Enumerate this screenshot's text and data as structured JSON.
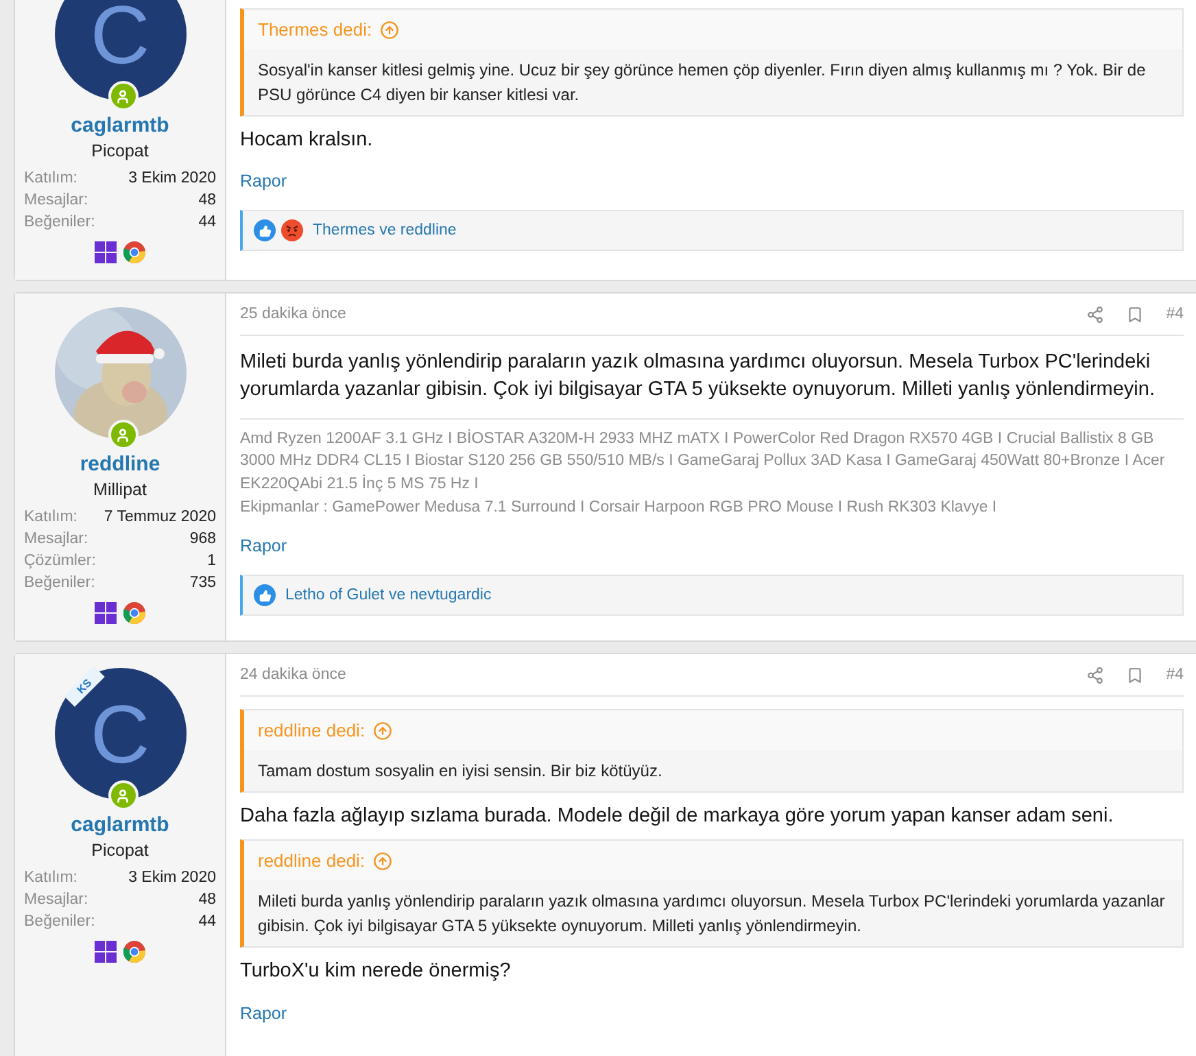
{
  "posts": [
    {
      "user": {
        "avatar": {
          "kind": "letter",
          "letter": "C"
        },
        "name": "caglarmtb",
        "role": "Picopat",
        "stats": [
          {
            "label": "Katılım:",
            "value": "3 Ekim 2020"
          },
          {
            "label": "Mesajlar:",
            "value": "48"
          },
          {
            "label": "Beğeniler:",
            "value": "44"
          }
        ]
      },
      "blocks": [
        {
          "kind": "quote",
          "author": "Thermes dedi:",
          "text": "Sosyal'in kanser kitlesi gelmiş yine. Ucuz bir şey görünce hemen çöp diyenler. Fırın diyen almış kullanmış mı ? Yok. Bir de PSU görünce C4 diyen bir kanser kitlesi var."
        },
        {
          "kind": "text",
          "text": "Hocam kralsın."
        }
      ],
      "report": "Rapor",
      "reactions": {
        "icons": [
          {
            "kind": "like"
          },
          {
            "kind": "angry"
          }
        ],
        "text": "Thermes ve reddline"
      }
    },
    {
      "header": {
        "time": "25 dakika önce",
        "number": "#4"
      },
      "user": {
        "name": "reddline",
        "role": "Millipat",
        "stats": [
          {
            "label": "Katılım:",
            "value": "7 Temmuz 2020"
          },
          {
            "label": "Mesajlar:",
            "value": "968"
          },
          {
            "label": "Çözümler:",
            "value": "1"
          },
          {
            "label": "Beğeniler:",
            "value": "735"
          }
        ]
      },
      "blocks": [
        {
          "kind": "text",
          "text": "Mileti burda yanlış yönlendirip paraların yazık olmasına yardımcı oluyorsun. Mesela Turbox PC'lerindeki yorumlarda yazanlar gibisin. Çok iyi bilgisayar GTA 5 yüksekte oynuyorum. Milleti yanlış yönlendirmeyin."
        }
      ],
      "signature": [
        "Amd Ryzen 1200AF 3.1 GHz I BİOSTAR A320M-H 2933 MHZ mATX I PowerColor Red Dragon RX570 4GB I Crucial Ballistix 8 GB 3000 MHz DDR4 CL15 I Biostar S120 256 GB 550/510 MB/s I GameGaraj Pollux 3AD Kasa I GameGaraj 450Watt 80+Bronze I Acer EK220QAbi 21.5 İnç 5 MS 75 Hz I",
        "Ekipmanlar : GamePower Medusa 7.1 Surround I Corsair Harpoon RGB PRO Mouse I Rush RK303 Klavye I"
      ],
      "report": "Rapor",
      "reactions": {
        "icons": [
          {
            "kind": "like"
          }
        ],
        "text": "Letho of Gulet ve nevtugardic"
      }
    },
    {
      "header": {
        "time": "24 dakika önce",
        "number": "#4"
      },
      "user": {
        "avatar": {
          "kind": "letter",
          "letter": "C",
          "ribbon": "KS"
        },
        "name": "caglarmtb",
        "role": "Picopat",
        "stats": [
          {
            "label": "Katılım:",
            "value": "3 Ekim 2020"
          },
          {
            "label": "Mesajlar:",
            "value": "48"
          },
          {
            "label": "Beğeniler:",
            "value": "44"
          }
        ]
      },
      "blocks": [
        {
          "kind": "quote",
          "author": "reddline dedi:",
          "text": "Tamam dostum sosyalin en iyisi sensin. Bir biz kötüyüz."
        },
        {
          "kind": "text",
          "text": "Daha fazla ağlayıp sızlama burada. Modele değil de markaya göre yorum yapan kanser adam seni."
        },
        {
          "kind": "quote",
          "author": "reddline dedi:",
          "text": "Mileti burda yanlış yönlendirip paraların yazık olmasına yardımcı oluyorsun. Mesela Turbox PC'lerindeki yorumlarda yazanlar gibisin. Çok iyi bilgisayar GTA 5 yüksekte oynuyorum. Milleti yanlış yönlendirmeyin."
        },
        {
          "kind": "text",
          "text": "TurboX'u kim nerede önermiş?"
        }
      ],
      "report": "Rapor"
    }
  ]
}
